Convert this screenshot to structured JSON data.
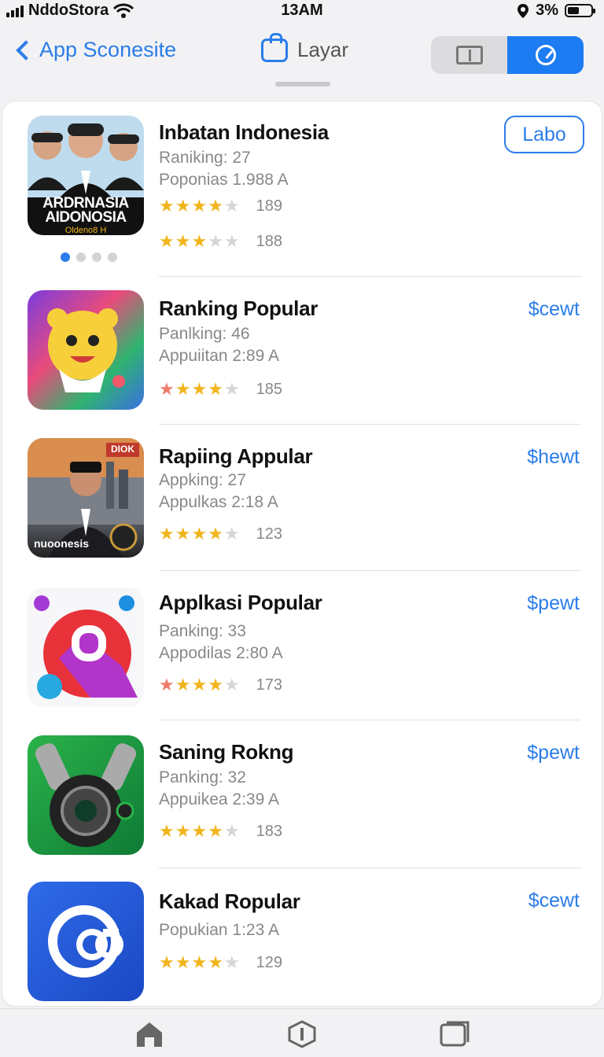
{
  "status": {
    "carrier": "NddoStora",
    "time": "13AM",
    "battery": "3%"
  },
  "nav": {
    "back_label": "App Sconesite",
    "title": "Layar"
  },
  "apps": [
    {
      "name": "Inbatan Indonesia",
      "line1": "Raniking: 27",
      "line2": "Poponias 1.988  A",
      "ratings": [
        {
          "stars": "★★★★★",
          "count": "189"
        },
        {
          "stars": "★★★★★",
          "count": "188"
        }
      ],
      "action": "Labo",
      "icon_text": "ARDRNASIA AIDONOSIA",
      "icon_sub": "Oldeno8 H"
    },
    {
      "name": "Ranking Popular",
      "line1": "Panlking: 46",
      "line2": "Appuiitan 2:89  A",
      "ratings": [
        {
          "stars": "★★★★★",
          "count": "185"
        }
      ],
      "action": "$cewt"
    },
    {
      "name": "Rapiing Appular",
      "line1": "Appking: 27",
      "line2": "Appulkas 2:18  A",
      "ratings": [
        {
          "stars": "★★★★★",
          "count": "123"
        }
      ],
      "action": "$hewt",
      "icon_text": "nuoonesis",
      "icon_badge": "DIOK"
    },
    {
      "name": "Applkasi Popular",
      "line1": "Panking: 33",
      "line2": "Appodilas 2:80  A",
      "ratings": [
        {
          "stars": "★★★★★",
          "count": "173"
        }
      ],
      "action": "$pewt"
    },
    {
      "name": "Saning Rokng",
      "line1": "Panking: 32",
      "line2": "Appuikea 2:39  A",
      "ratings": [
        {
          "stars": "★★★★★",
          "count": "183"
        }
      ],
      "action": "$pewt"
    },
    {
      "name": "Kakad Ropular",
      "line1": "Popukian 1:23  A",
      "ratings": [
        {
          "stars": "★★★★★",
          "count": "129"
        }
      ],
      "action": "$cewt"
    }
  ],
  "colors": {
    "accent": "#2b7de9",
    "star": "#f1b51c",
    "star_red": "#f07a6a"
  },
  "icons": [
    "signal-icon",
    "wifi-icon",
    "location-icon",
    "battery-icon",
    "back-chevron-icon",
    "bag-icon",
    "book-icon",
    "compass-icon",
    "home-icon",
    "info-icon",
    "box-icon"
  ]
}
